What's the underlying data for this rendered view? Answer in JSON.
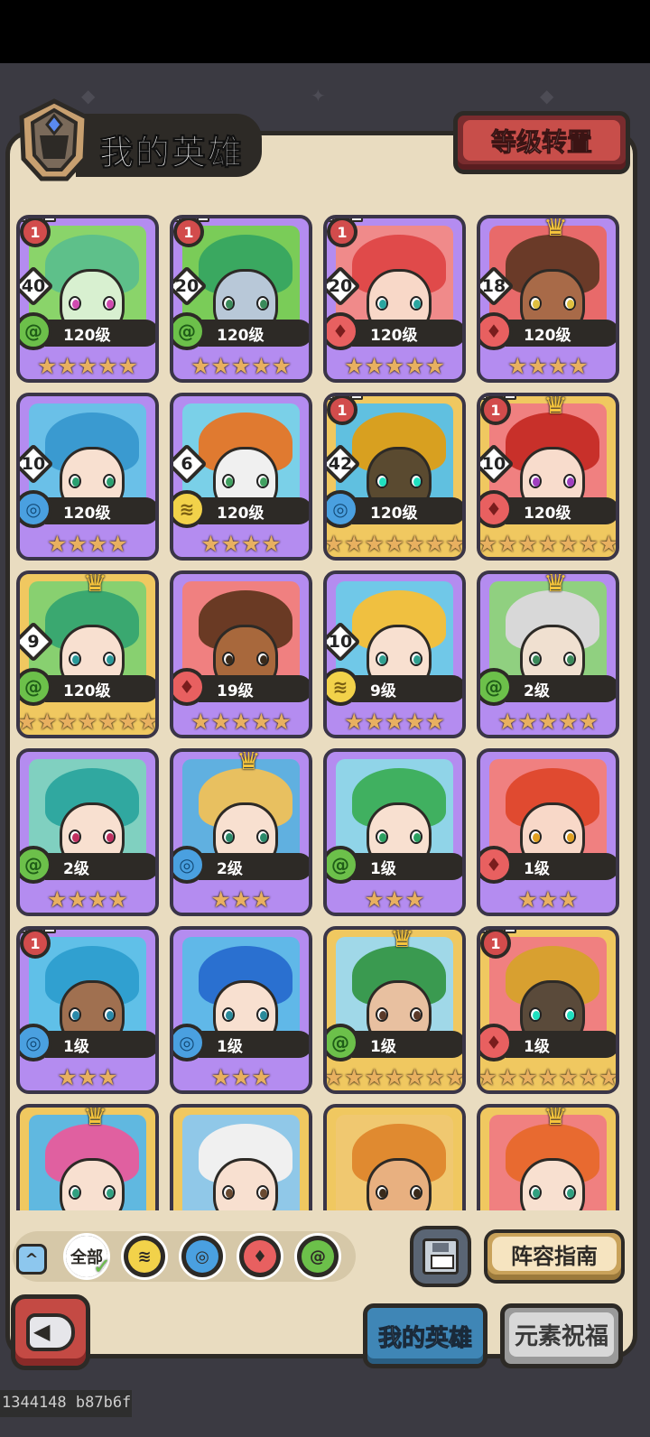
{
  "header": {
    "title": "我的英雄",
    "level_transfer_label": "等级转置"
  },
  "heroes": [
    {
      "rank": "1",
      "count": "40",
      "element": "wind",
      "level": "120级",
      "stars": "★★★★★",
      "frame": "purple",
      "crown": false,
      "hair": "#5ec08a",
      "skin": "#d8f0d0",
      "bg": "#8ad46a",
      "iris": "#d04ab0"
    },
    {
      "rank": "1",
      "count": "20",
      "element": "wind",
      "level": "120级",
      "stars": "★★★★★",
      "frame": "purple",
      "crown": false,
      "hair": "#3aa860",
      "skin": "#b8c8d8",
      "bg": "#7acc58",
      "iris": "#3a8a5a"
    },
    {
      "rank": "1",
      "count": "20",
      "element": "fire",
      "level": "120级",
      "stars": "★★★★★",
      "frame": "purple",
      "crown": false,
      "hair": "#e04a4a",
      "skin": "#f8d8c8",
      "bg": "#f08a8a",
      "iris": "#2aa6a0"
    },
    {
      "rank": "",
      "count": "18",
      "element": "fire",
      "level": "120级",
      "stars": "★★★★",
      "frame": "purple",
      "crown": true,
      "hair": "#6a3a28",
      "skin": "#a86a48",
      "bg": "#e86a6a",
      "iris": "#e0c040"
    },
    {
      "rank": "",
      "count": "10",
      "element": "water",
      "level": "120级",
      "stars": "★★★★",
      "frame": "purple",
      "crown": false,
      "hair": "#3a9ad0",
      "skin": "#f8e0d0",
      "bg": "#6ac0e8",
      "iris": "#2aa070"
    },
    {
      "rank": "",
      "count": "6",
      "element": "earth",
      "level": "120级",
      "stars": "★★★★",
      "frame": "purple",
      "crown": false,
      "hair": "#e07a30",
      "skin": "#f0f0f0",
      "bg": "#7ad0e8",
      "iris": "#40a060"
    },
    {
      "rank": "1",
      "count": "42",
      "element": "water",
      "level": "120级",
      "stars": "★★★★★★★",
      "frame": "gold",
      "crown": false,
      "hair": "#d8a020",
      "skin": "#5a4a30",
      "bg": "#60c0e0",
      "iris": "#20e0c0"
    },
    {
      "rank": "1",
      "count": "10",
      "element": "fire",
      "level": "120级",
      "stars": "★★★★★★★",
      "frame": "gold",
      "crown": true,
      "hair": "#c8302a",
      "skin": "#f8dccc",
      "bg": "#f08080",
      "iris": "#a040c0"
    },
    {
      "rank": "",
      "count": "9",
      "element": "wind",
      "level": "120级",
      "stars": "★★★★★★★",
      "frame": "gold",
      "crown": true,
      "hair": "#3aa870",
      "skin": "#f8e0d0",
      "bg": "#88d070",
      "iris": "#2a9a9a"
    },
    {
      "rank": "",
      "count": "",
      "element": "fire",
      "level": "19级",
      "stars": "★★★★★",
      "frame": "purple",
      "crown": false,
      "hair": "#6a3a24",
      "skin": "#a8683c",
      "bg": "#f08080",
      "iris": "#3a2a1a"
    },
    {
      "rank": "",
      "count": "10",
      "element": "earth",
      "level": "9级",
      "stars": "★★★★★",
      "frame": "purple",
      "crown": false,
      "hair": "#f0c040",
      "skin": "#f8e0d0",
      "bg": "#70c8e8",
      "iris": "#30a090"
    },
    {
      "rank": "",
      "count": "",
      "element": "wind",
      "level": "2级",
      "stars": "★★★★★",
      "frame": "purple",
      "crown": true,
      "hair": "#d8d8d8",
      "skin": "#f0e0d0",
      "bg": "#90d080",
      "iris": "#3a8a5a"
    },
    {
      "rank": "",
      "count": "",
      "element": "wind",
      "level": "2级",
      "stars": "★★★★",
      "frame": "purple",
      "crown": false,
      "hair": "#30a8a0",
      "skin": "#f8e0d0",
      "bg": "#80d0c0",
      "iris": "#c03060"
    },
    {
      "rank": "",
      "count": "",
      "element": "water",
      "level": "2级",
      "stars": "★★★",
      "frame": "purple",
      "crown": true,
      "hair": "#e8c060",
      "skin": "#f8e0d0",
      "bg": "#60b0e0",
      "iris": "#2a8a6a"
    },
    {
      "rank": "",
      "count": "",
      "element": "wind",
      "level": "1级",
      "stars": "★★★",
      "frame": "purple",
      "crown": false,
      "hair": "#40b060",
      "skin": "#f8e0d0",
      "bg": "#90d4e8",
      "iris": "#2aa060"
    },
    {
      "rank": "",
      "count": "",
      "element": "fire",
      "level": "1级",
      "stars": "★★★",
      "frame": "purple",
      "crown": false,
      "hair": "#e04a30",
      "skin": "#f8d8c8",
      "bg": "#f08080",
      "iris": "#e0a020"
    },
    {
      "rank": "1",
      "count": "",
      "element": "water",
      "level": "1级",
      "stars": "★★★",
      "frame": "purple",
      "crown": false,
      "hair": "#30a0d0",
      "skin": "#a07050",
      "bg": "#60c0e8",
      "iris": "#2a8aaa"
    },
    {
      "rank": "",
      "count": "",
      "element": "water",
      "level": "1级",
      "stars": "★★★",
      "frame": "purple",
      "crown": false,
      "hair": "#2a70d0",
      "skin": "#f8e0d0",
      "bg": "#60b8e8",
      "iris": "#2a8a9a"
    },
    {
      "rank": "",
      "count": "",
      "element": "wind",
      "level": "1级",
      "stars": "★★★★★★★",
      "frame": "gold",
      "crown": true,
      "hair": "#3a9a50",
      "skin": "#e8c0a0",
      "bg": "#a0d8e8",
      "iris": "#5a3a2a"
    },
    {
      "rank": "1",
      "count": "",
      "element": "fire",
      "level": "1级",
      "stars": "★★★★★★★",
      "frame": "gold",
      "crown": false,
      "hair": "#d8a030",
      "skin": "#5a4a3a",
      "bg": "#f08080",
      "iris": "#20e0c0"
    },
    {
      "rank": "",
      "count": "",
      "element": "",
      "level": "",
      "stars": "",
      "frame": "gold",
      "crown": true,
      "hair": "#e060a0",
      "skin": "#f8e0d0",
      "bg": "#60b8e0",
      "iris": "#30a080"
    },
    {
      "rank": "",
      "count": "",
      "element": "",
      "level": "",
      "stars": "",
      "frame": "gold",
      "crown": false,
      "hair": "#f0f0f0",
      "skin": "#f8e0d0",
      "bg": "#90c8e8",
      "iris": "#6a4a30"
    },
    {
      "rank": "",
      "count": "",
      "element": "",
      "level": "",
      "stars": "",
      "frame": "gold",
      "crown": false,
      "hair": "#e08a30",
      "skin": "#e8b080",
      "bg": "#f0c870",
      "iris": "#3a2a1a"
    },
    {
      "rank": "",
      "count": "",
      "element": "",
      "level": "",
      "stars": "",
      "frame": "gold",
      "crown": true,
      "hair": "#e86a30",
      "skin": "#f8e0d0",
      "bg": "#f08080",
      "iris": "#30a080"
    }
  ],
  "element_glyphs": {
    "wind": "@",
    "fire": "♦",
    "water": "◎",
    "earth": "≋"
  },
  "filters": {
    "collapse_label": "^",
    "all_label": "全部",
    "check": "✓",
    "chips": [
      {
        "name": "earth",
        "color": "#f2d24a",
        "glyph": "≋"
      },
      {
        "name": "water",
        "color": "#4aa0e0",
        "glyph": "◎"
      },
      {
        "name": "fire",
        "color": "#e86060",
        "glyph": "♦"
      },
      {
        "name": "wind",
        "color": "#6cc04a",
        "glyph": "@"
      }
    ]
  },
  "lineup_label": "阵容指南",
  "tabs": {
    "my_heroes": "我的英雄",
    "element_blessing": "元素祝福"
  },
  "build_tag": "1344148 b87b6f"
}
